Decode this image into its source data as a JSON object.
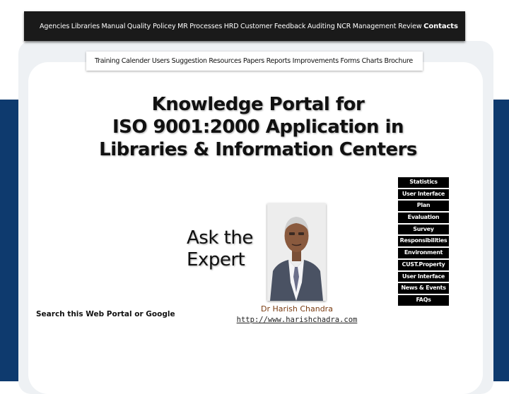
{
  "top_nav": [
    "Agencies",
    "Libraries",
    "Manual",
    "Quality Policey",
    "MR",
    "Processes",
    "HRD",
    "Customer",
    "Feedback",
    "Auditing",
    "NCR",
    "Management Review",
    "Contacts"
  ],
  "sub_nav": [
    "Training Calender",
    "Users Suggestion",
    "Resources",
    "Papers",
    "Reports",
    "Improvements",
    "Forms",
    "Charts",
    "Brochure"
  ],
  "title": {
    "line1": "Knowledge Portal for",
    "line2": "ISO 9001:2000 Application in",
    "line3": "Libraries & Information Centers"
  },
  "ask": {
    "line1": "Ask the",
    "line2": "Expert"
  },
  "expert": {
    "name": "Dr Harish Chandra",
    "url": "http://www.harishchadra.com"
  },
  "search_label": "Search this Web Portal or Google",
  "side_menu": [
    "Statistics",
    "User Interface",
    "Plan",
    "Evaluation",
    "Survey",
    "Responsibilities",
    "Environment",
    "CUST.Property",
    "User Interface",
    "News & Events",
    "FAQs"
  ],
  "colors": {
    "nav_bg": "#1a1a1a",
    "band_blue": "#0e3a6e",
    "expert_name": "#7a3b10"
  }
}
